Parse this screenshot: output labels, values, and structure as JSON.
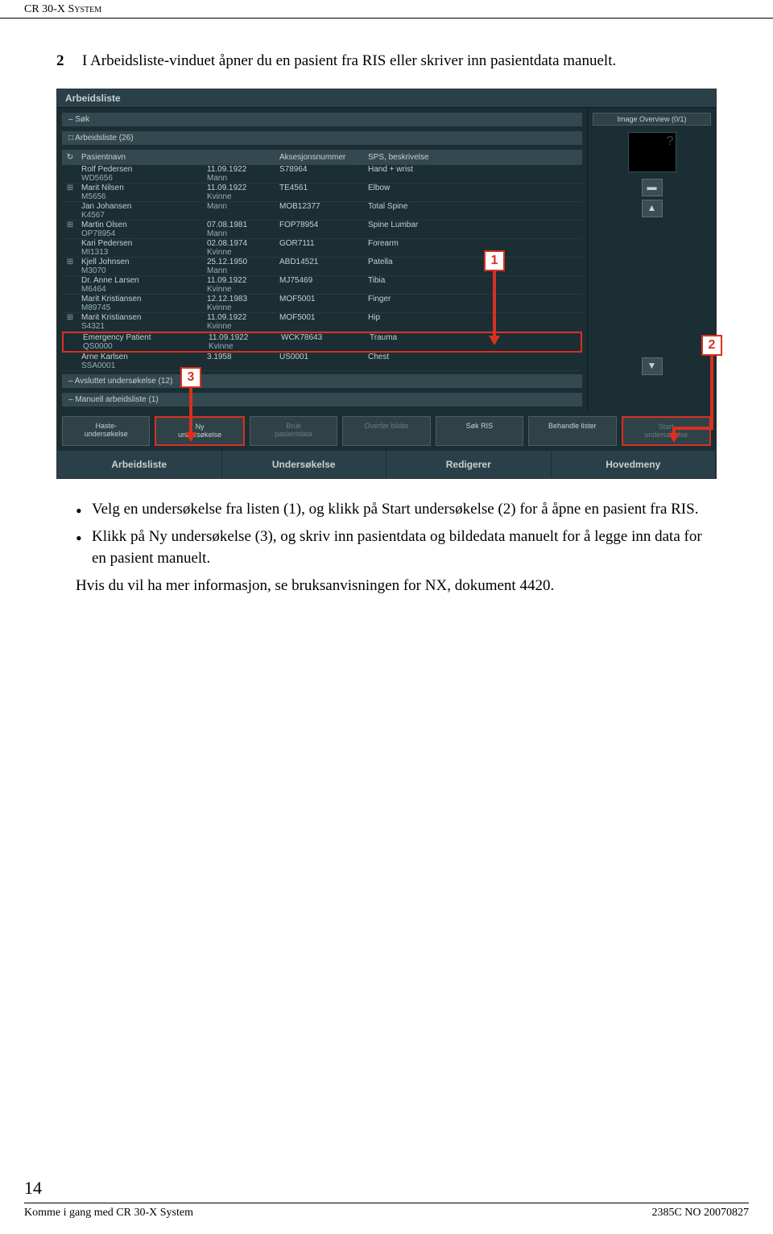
{
  "header": {
    "title": "CR 30-X System"
  },
  "step": {
    "num": "2",
    "text": "I Arbeidsliste-vinduet åpner du en pasient fra RIS eller skriver inn pasientdata manuelt."
  },
  "screenshot": {
    "title": "Arbeidsliste",
    "sok": "– Søk",
    "worklist": "□ Arbeidsliste (26)",
    "headers": {
      "refresh": "↻",
      "name": "Pasientnavn",
      "acc": "Aksesjonsnummer",
      "sps": "SPS, beskrivelse"
    },
    "rows": [
      {
        "name": "Rolf Pedersen",
        "id": "WD5656",
        "dob": "11.09.1922",
        "sex": "Mann",
        "acc": "S78964",
        "sps": "Hand + wrist",
        "plus": false
      },
      {
        "name": "Marit Nilsen",
        "id": "M5656",
        "dob": "11.09.1922",
        "sex": "Kvinne",
        "acc": "TE4561",
        "sps": "Elbow",
        "plus": true
      },
      {
        "name": "Jan Johansen",
        "id": "K4567",
        "dob": "",
        "sex": "Mann",
        "acc": "MOB12377",
        "sps": "Total Spine",
        "plus": false
      },
      {
        "name": "Martin Olsen",
        "id": "OP78954",
        "dob": "07.08.1981",
        "sex": "Mann",
        "acc": "FOP78954",
        "sps": "Spine Lumbar",
        "plus": true
      },
      {
        "name": "Kari Pedersen",
        "id": "MI1313",
        "dob": "02.08.1974",
        "sex": "Kvinne",
        "acc": "GOR7111",
        "sps": "Forearm",
        "plus": false
      },
      {
        "name": "Kjell Johnsen",
        "id": "M3070",
        "dob": "25.12.1950",
        "sex": "Mann",
        "acc": "ABD14521",
        "sps": "Patella",
        "plus": true
      },
      {
        "name": "Dr. Anne Larsen",
        "id": "M6464",
        "dob": "11.09.1922",
        "sex": "Kvinne",
        "acc": "MJ75469",
        "sps": "Tibia",
        "plus": false
      },
      {
        "name": "Marit Kristiansen",
        "id": "M89745",
        "dob": "12.12.1983",
        "sex": "Kvinne",
        "acc": "MOF5001",
        "sps": "Finger",
        "plus": false
      },
      {
        "name": "Marit Kristiansen",
        "id": "S4321",
        "dob": "11.09.1922",
        "sex": "Kvinne",
        "acc": "MOF5001",
        "sps": "Hip",
        "plus": true
      },
      {
        "name": "Emergency Patient",
        "id": "QS0000",
        "dob": "11.09.1922",
        "sex": "Kvinne",
        "acc": "WCK78643",
        "sps": "Trauma",
        "plus": false,
        "hl": true
      },
      {
        "name": "Arne Karlsen",
        "id": "SSA0001",
        "dob": "3.1958",
        "sex": "",
        "acc": "US0001",
        "sps": "Chest",
        "plus": false
      }
    ],
    "closed1": "– Avsluttet undersøkelse (12)",
    "closed2": "– Manuell arbeidsliste (1)",
    "buttons": [
      {
        "l1": "Haste-",
        "l2": "undersøkelse",
        "dim": false,
        "hl": false
      },
      {
        "l1": "Ny",
        "l2": "undersøkelse",
        "dim": false,
        "hl": true
      },
      {
        "l1": "Bruk",
        "l2": "pasientdata",
        "dim": true,
        "hl": false
      },
      {
        "l1": "Overfør bilder",
        "l2": "",
        "dim": true,
        "hl": false
      },
      {
        "l1": "Søk RIS",
        "l2": "",
        "dim": false,
        "hl": false
      },
      {
        "l1": "Behandle lister",
        "l2": "",
        "dim": false,
        "hl": false
      },
      {
        "l1": "Start",
        "l2": "undersøkelse",
        "dim": true,
        "hl": true
      }
    ],
    "tabs": [
      "Arbeidsliste",
      "Undersøkelse",
      "Redigerer",
      "Hovedmeny"
    ],
    "image_overview": "Image Overview (0/1)",
    "thumb_label": "?",
    "callouts": {
      "c1": "1",
      "c2": "2",
      "c3": "3"
    }
  },
  "bullets": [
    "Velg en undersøkelse fra listen (1), og klikk på Start undersøkelse (2) for å åpne en pasient fra RIS.",
    "Klikk på Ny undersøkelse (3), og skriv inn pasientdata og bildedata manuelt for å legge inn data for en pasient manuelt."
  ],
  "closing": "Hvis du vil ha mer informasjon, se bruksanvisningen for NX, dokument 4420.",
  "footer": {
    "page": "14",
    "left": "Komme i gang med CR 30-X System",
    "right": "2385C NO 20070827"
  }
}
